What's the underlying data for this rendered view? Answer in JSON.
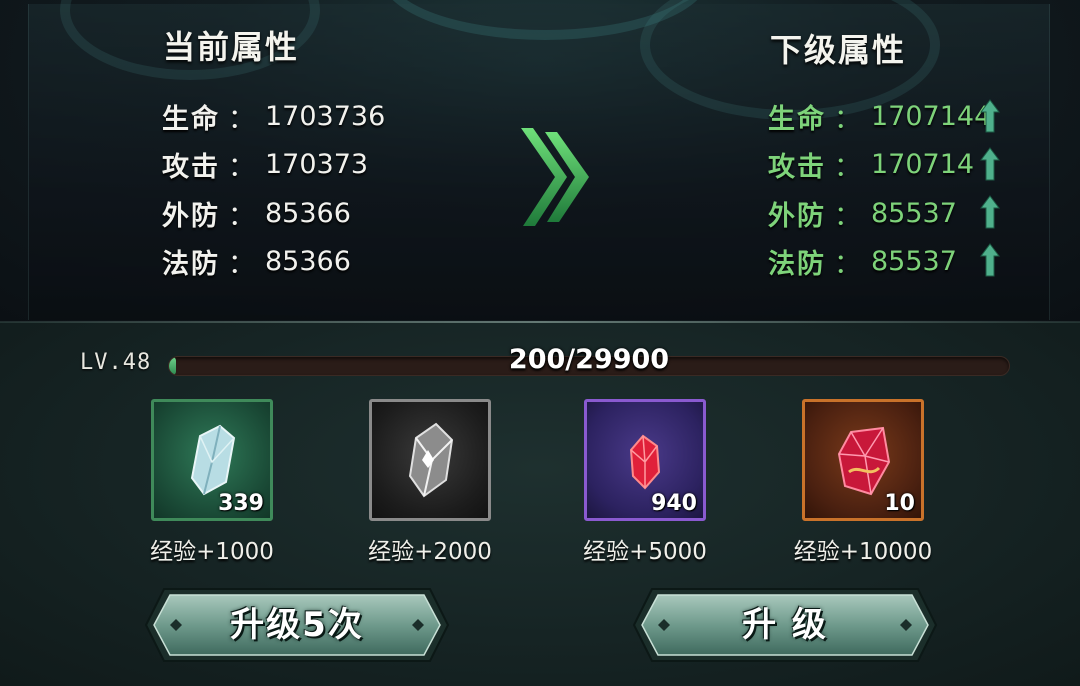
{
  "current": {
    "title": "当前属性",
    "stats": [
      {
        "label": "生命",
        "value": "1703736"
      },
      {
        "label": "攻击",
        "value": "170373"
      },
      {
        "label": "外防",
        "value": "85366"
      },
      {
        "label": "法防",
        "value": "85366"
      }
    ]
  },
  "next": {
    "title": "下级属性",
    "stats": [
      {
        "label": "生命",
        "value": "1707144"
      },
      {
        "label": "攻击",
        "value": "170714"
      },
      {
        "label": "外防",
        "value": "85537"
      },
      {
        "label": "法防",
        "value": "85537"
      }
    ]
  },
  "separator": "：",
  "level": {
    "label": "LV.48",
    "exp_text": "200/29900",
    "progress": 0.0067
  },
  "items": [
    {
      "count": "339",
      "caption": "经验+1000",
      "rarity": "green",
      "icon": "crystal-gem-icon"
    },
    {
      "count": "",
      "caption": "经验+2000",
      "rarity": "grey",
      "icon": "crystal-gem-icon"
    },
    {
      "count": "940",
      "caption": "经验+5000",
      "rarity": "purple",
      "icon": "ruby-gem-icon"
    },
    {
      "count": "10",
      "caption": "经验+10000",
      "rarity": "orange",
      "icon": "ruby-gem-icon"
    }
  ],
  "buttons": {
    "upgrade_five": "升级5次",
    "upgrade": "升 级"
  },
  "colors": {
    "next_stat": "#7ed37a",
    "up_arrow": "#4fb08c",
    "frame_green": "#3f8a5a",
    "frame_grey": "#8a8a8a",
    "frame_purple": "#8a5ad0",
    "frame_orange": "#c9722a"
  }
}
